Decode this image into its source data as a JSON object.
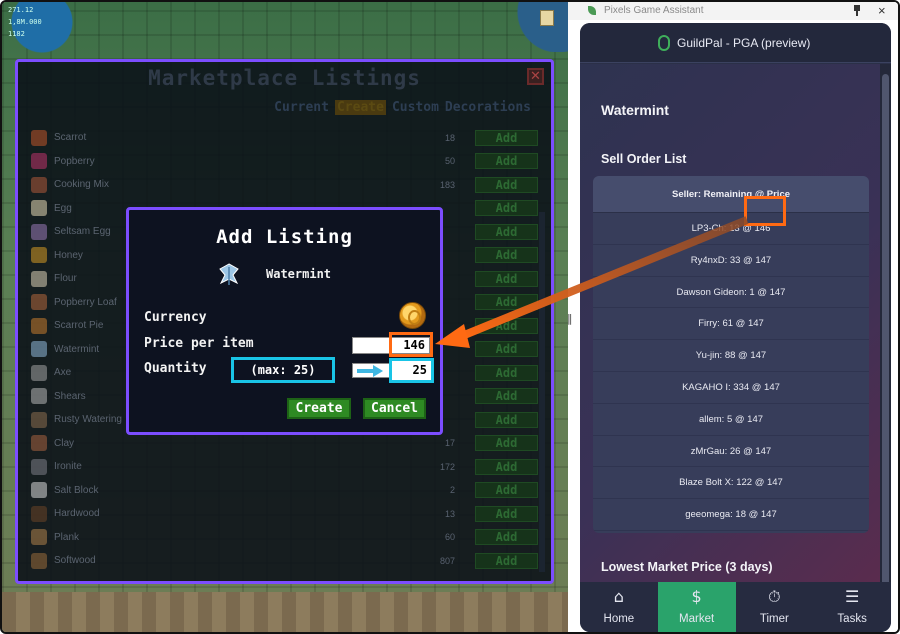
{
  "game": {
    "hud_lines": [
      "271.12",
      "1,8M.000",
      "1182"
    ],
    "marketplace": {
      "title": "Marketplace Listings",
      "close": "✕",
      "tabs": [
        {
          "label": "Current",
          "active": false
        },
        {
          "label": "Create",
          "active": true
        },
        {
          "label": "Custom",
          "active": false
        },
        {
          "label": "Decorations",
          "active": false
        }
      ],
      "add_label": "Add",
      "items": [
        {
          "name": "Scarrot",
          "count": "18",
          "color": "#c0562a"
        },
        {
          "name": "Popberry",
          "count": "50",
          "color": "#c0336b"
        },
        {
          "name": "Cooking Mix",
          "count": "183",
          "color": "#b05a3b"
        },
        {
          "name": "Egg",
          "count": "",
          "color": "#e6d9b5"
        },
        {
          "name": "Seltsam Egg",
          "count": "",
          "color": "#9a7ab8"
        },
        {
          "name": "Honey",
          "count": "",
          "color": "#d59a24"
        },
        {
          "name": "Flour",
          "count": "",
          "color": "#ddd2b6"
        },
        {
          "name": "Popberry Loaf",
          "count": "",
          "color": "#b5683d"
        },
        {
          "name": "Scarrot Pie",
          "count": "",
          "color": "#c77c2d"
        },
        {
          "name": "Watermint",
          "count": "",
          "color": "#8fb8d9"
        },
        {
          "name": "Axe",
          "count": "",
          "color": "#a3a3a3"
        },
        {
          "name": "Shears",
          "count": "",
          "color": "#b7b7b7"
        },
        {
          "name": "Rusty Watering",
          "count": "",
          "color": "#8c6d4f"
        },
        {
          "name": "Clay",
          "count": "17",
          "color": "#a8633f"
        },
        {
          "name": "Ironite",
          "count": "172",
          "color": "#7d7d86"
        },
        {
          "name": "Salt Block",
          "count": "2",
          "color": "#d9d9d9"
        },
        {
          "name": "Hardwood",
          "count": "13",
          "color": "#6b4426"
        },
        {
          "name": "Plank",
          "count": "60",
          "color": "#b0824b"
        },
        {
          "name": "Softwood",
          "count": "807",
          "color": "#9a6b3a"
        }
      ]
    },
    "add_listing": {
      "title": "Add Listing",
      "item_name": "Watermint",
      "currency_label": "Currency",
      "price_label": "Price per item",
      "price_value": "146",
      "quantity_label": "Quantity",
      "max_text": "(max: 25)",
      "quantity_value": "25",
      "create_label": "Create",
      "cancel_label": "Cancel"
    }
  },
  "panel": {
    "window_title": "Pixels Game Assistant",
    "app_title": "GuildPal - PGA (preview)",
    "item_name": "Watermint",
    "sell_order_heading": "Sell Order List",
    "orders_header": "Seller: Remaining @ Price",
    "orders": [
      "LP3-Ch: 13 @ 146",
      "Ry4nxD: 33 @ 147",
      "Dawson Gideon: 1 @ 147",
      "Firry: 61 @ 147",
      "Yu-jin: 88 @ 147",
      "KAGAHO I: 334 @ 147",
      "allem: 5 @ 147",
      "zMrGau: 26 @ 147",
      "Blaze Bolt X: 122 @ 147",
      "geeomega: 18 @ 147"
    ],
    "lowest_heading": "Lowest Market Price (3 days)",
    "tabs": [
      {
        "label": "Home",
        "icon": "home-icon",
        "glyph": "⌂",
        "active": false
      },
      {
        "label": "Market",
        "icon": "dollar-icon",
        "glyph": "$",
        "active": true
      },
      {
        "label": "Timer",
        "icon": "stopwatch-icon",
        "glyph": "⏱",
        "active": false
      },
      {
        "label": "Tasks",
        "icon": "list-icon",
        "glyph": "☰",
        "active": false
      }
    ]
  },
  "colors": {
    "highlight_orange": "#ff6a13",
    "highlight_cyan": "#19c4e6",
    "dialog_border": "#7c4dff",
    "market_tab_active": "#2aa36b"
  }
}
